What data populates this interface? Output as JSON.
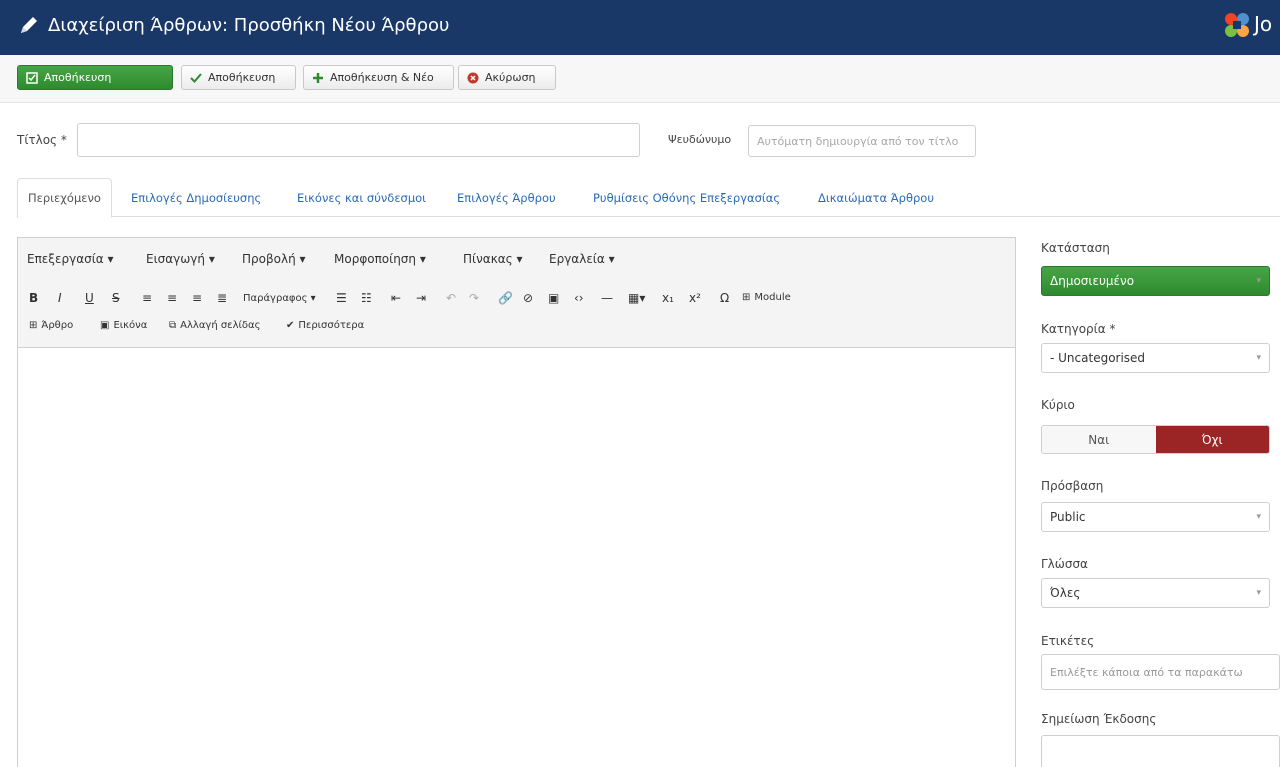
{
  "header": {
    "title": "Διαχείριση Άρθρων: Προσθήκη Νέου Άρθρου",
    "logo_text": "Jo"
  },
  "toolbar": {
    "save_label": "Αποθήκευση",
    "save_close_label": "Αποθήκευση",
    "save_new_label": "Αποθήκευση & Νέο",
    "cancel_label": "Ακύρωση"
  },
  "form": {
    "title_label": "Τίτλος *",
    "title_value": "",
    "alias_label": "Ψευδώνυμο",
    "alias_placeholder": "Αυτόματη δημιουργία από τον τίτλο"
  },
  "tabs": [
    {
      "label": "Περιεχόμενο"
    },
    {
      "label": "Επιλογές Δημοσίευσης"
    },
    {
      "label": "Εικόνες και σύνδεσμοι"
    },
    {
      "label": "Επιλογές Άρθρου"
    },
    {
      "label": "Ρυθμίσεις Οθόνης Επεξεργασίας"
    },
    {
      "label": "Δικαιώματα Άρθρου"
    }
  ],
  "editor": {
    "menus": [
      {
        "label": "Επεξεργασία ▾"
      },
      {
        "label": "Εισαγωγή ▾"
      },
      {
        "label": "Προβολή ▾"
      },
      {
        "label": "Μορφοποίηση ▾"
      },
      {
        "label": "Πίνακας ▾"
      },
      {
        "label": "Εργαλεία ▾"
      }
    ],
    "paragraph_label": "Παράγραφος ▾",
    "module_label": "Module",
    "article_label": "Άρθρο",
    "image_label": "Εικόνα",
    "pagebreak_label": "Αλλαγή σελίδας",
    "readmore_label": "Περισσότερα"
  },
  "sidebar": {
    "status_label": "Κατάσταση",
    "status_value": "Δημοσιευμένο",
    "category_label": "Κατηγορία *",
    "category_value": "- Uncategorised",
    "featured_label": "Κύριο",
    "featured_yes": "Ναι",
    "featured_no": "Όχι",
    "access_label": "Πρόσβαση",
    "access_value": "Public",
    "language_label": "Γλώσσα",
    "language_value": "Όλες",
    "tags_label": "Ετικέτες",
    "tags_placeholder": "Επιλέξτε κάποια από τα παρακάτω",
    "version_note_label": "Σημείωση Έκδοσης"
  },
  "colors": {
    "header_bg": "#1a3867",
    "primary_green": "#2f8a2f",
    "toggle_no_red": "#9b2525",
    "link_blue": "#2a69b8"
  }
}
